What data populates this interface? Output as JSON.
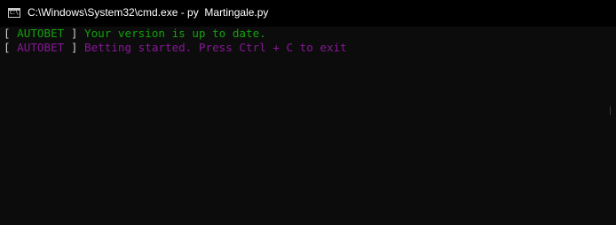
{
  "window": {
    "title": "C:\\Windows\\System32\\cmd.exe - py  Martingale.py",
    "icon": "cmd-icon",
    "icon_text": "C:\\."
  },
  "console": {
    "lines": [
      {
        "bracket_open": "[",
        "tag": " AUTOBET ",
        "bracket_close": "]",
        "message": " Your version is up to date.",
        "color": "#13a10e"
      },
      {
        "bracket_open": "[",
        "tag": " AUTOBET ",
        "bracket_close": "]",
        "message": " Betting started. Press Ctrl + C to exit",
        "color": "#881798"
      }
    ],
    "bracket_color": "#cccccc"
  }
}
